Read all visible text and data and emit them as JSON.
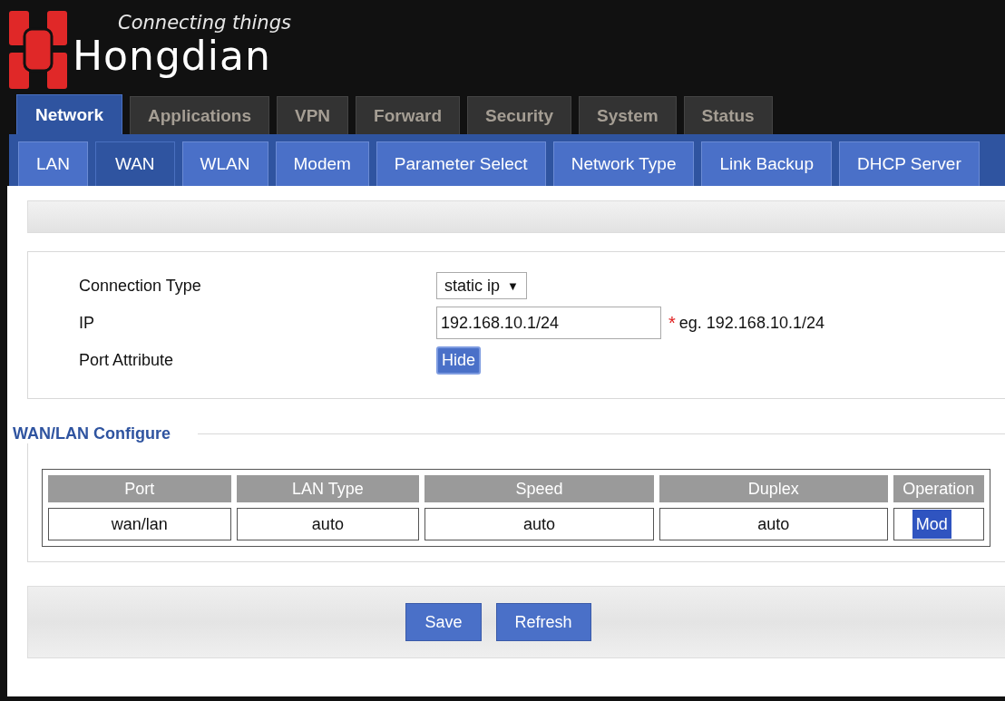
{
  "header": {
    "tagline": "Connecting things",
    "brand": "Hongdian"
  },
  "menu": [
    {
      "label": "Network",
      "selected": true
    },
    {
      "label": "Applications",
      "selected": false
    },
    {
      "label": "VPN",
      "selected": false
    },
    {
      "label": "Forward",
      "selected": false
    },
    {
      "label": "Security",
      "selected": false
    },
    {
      "label": "System",
      "selected": false
    },
    {
      "label": "Status",
      "selected": false
    }
  ],
  "submenu": [
    {
      "label": "LAN",
      "selected": false
    },
    {
      "label": "WAN",
      "selected": true
    },
    {
      "label": "WLAN",
      "selected": false
    },
    {
      "label": "Modem",
      "selected": false
    },
    {
      "label": "Parameter Select",
      "selected": false
    },
    {
      "label": "Network Type",
      "selected": false
    },
    {
      "label": "Link Backup",
      "selected": false
    },
    {
      "label": "DHCP Server",
      "selected": false
    }
  ],
  "form": {
    "connection_type": {
      "label": "Connection Type",
      "value": "static ip",
      "caret": "▼"
    },
    "ip": {
      "label": "IP",
      "value": "192.168.10.1/24",
      "required": "*",
      "hint": "eg. 192.168.10.1/24"
    },
    "port_attribute": {
      "label": "Port Attribute",
      "button": "Hide"
    }
  },
  "wan_lan": {
    "title": "WAN/LAN Configure",
    "columns": [
      "Port",
      "LAN Type",
      "Speed",
      "Duplex",
      "Operation"
    ],
    "rows": [
      {
        "cells": [
          "wan/lan",
          "auto",
          "auto",
          "auto"
        ],
        "action": "Mod"
      }
    ]
  },
  "buttons": [
    "Save",
    "Refresh"
  ]
}
